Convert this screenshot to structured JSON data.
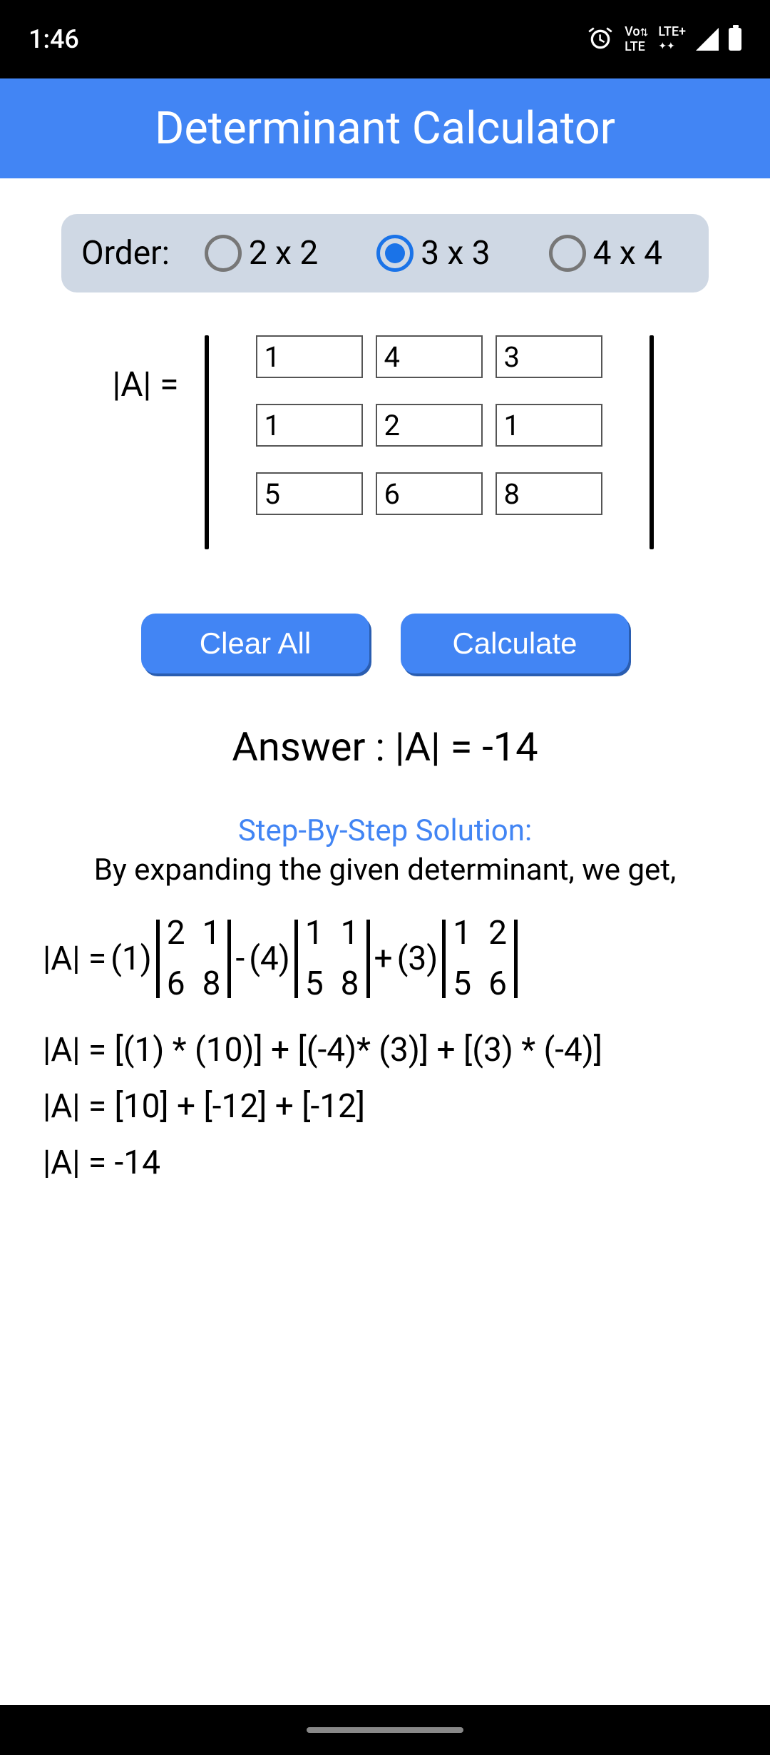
{
  "status": {
    "time": "1:46",
    "lte_top": "Vo",
    "lte_bot": "LTE",
    "lte_plus": "LTE+"
  },
  "header": {
    "title": "Determinant Calculator"
  },
  "order": {
    "label": "Order:",
    "options": [
      "2 x 2",
      "3 x 3",
      "4 x 4"
    ],
    "selected": 1
  },
  "matrix": {
    "label": "|A| =",
    "cells": [
      "1",
      "4",
      "3",
      "1",
      "2",
      "1",
      "5",
      "6",
      "8"
    ]
  },
  "buttons": {
    "clear": "Clear All",
    "calculate": "Calculate"
  },
  "answer": "Answer : |A| = -14",
  "steps": {
    "title": "Step-By-Step Solution:",
    "intro": "By expanding the given determinant, we get,",
    "expansion": {
      "lead": "|A| = ",
      "terms": [
        {
          "coef": "(1)",
          "op": "",
          "m": [
            "2",
            "1",
            "6",
            "8"
          ]
        },
        {
          "coef": "(4)",
          "op": " - ",
          "m": [
            "1",
            "1",
            "5",
            "8"
          ]
        },
        {
          "coef": "(3)",
          "op": " + ",
          "m": [
            "1",
            "2",
            "5",
            "6"
          ]
        }
      ]
    },
    "lines": [
      "|A| = [(1) * (10)] + [(-4)* (3)] + [(3) * (-4)]",
      "|A| = [10] + [-12] + [-12]",
      "|A| = -14"
    ]
  }
}
